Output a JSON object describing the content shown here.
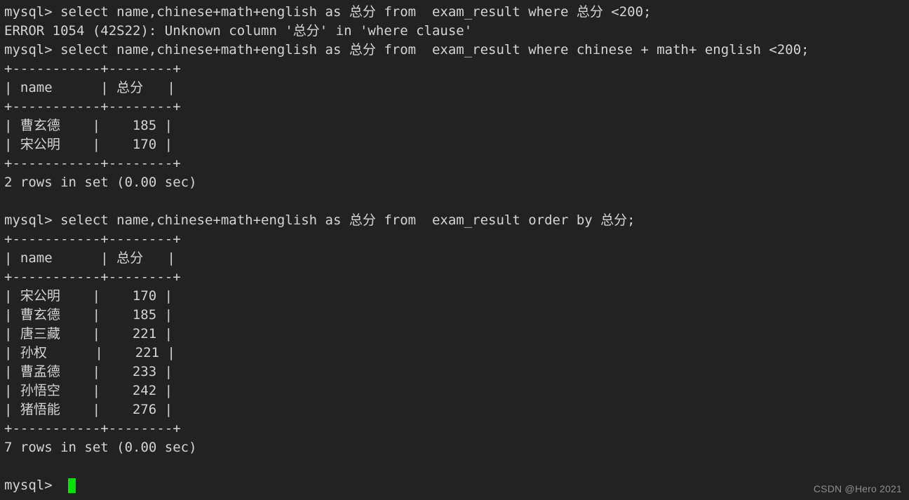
{
  "terminal": {
    "background_color": "#222222",
    "text_color": "#d4d4d4",
    "cursor_color": "#00e400",
    "prompt": "mysql> ",
    "lines": [
      {
        "id": "query-1",
        "text": "mysql> select name,chinese+math+english as 总分 from  exam_result where 总分 <200;"
      },
      {
        "id": "error-1",
        "text": "ERROR 1054 (42S22): Unknown column '总分' in 'where clause'"
      },
      {
        "id": "query-2",
        "text": "mysql> select name,chinese+math+english as 总分 from  exam_result where chinese + math+ english <200;"
      },
      {
        "id": "t1-sep-top",
        "text": "+-----------+--------+"
      },
      {
        "id": "t1-header",
        "text": "| name      | 总分   |"
      },
      {
        "id": "t1-sep-mid",
        "text": "+-----------+--------+"
      },
      {
        "id": "t1-row-1",
        "text": "| 曹玄德    |    185 |"
      },
      {
        "id": "t1-row-2",
        "text": "| 宋公明    |    170 |"
      },
      {
        "id": "t1-sep-bottom",
        "text": "+-----------+--------+"
      },
      {
        "id": "t1-rowcount",
        "text": "2 rows in set (0.00 sec)"
      },
      {
        "id": "spacer-1",
        "text": " "
      },
      {
        "id": "query-3",
        "text": "mysql> select name,chinese+math+english as 总分 from  exam_result order by 总分;"
      },
      {
        "id": "t2-sep-top",
        "text": "+-----------+--------+"
      },
      {
        "id": "t2-header",
        "text": "| name      | 总分   |"
      },
      {
        "id": "t2-sep-mid",
        "text": "+-----------+--------+"
      },
      {
        "id": "t2-row-1",
        "text": "| 宋公明    |    170 |"
      },
      {
        "id": "t2-row-2",
        "text": "| 曹玄德    |    185 |"
      },
      {
        "id": "t2-row-3",
        "text": "| 唐三藏    |    221 |"
      },
      {
        "id": "t2-row-4",
        "text": "| 孙权      |    221 |"
      },
      {
        "id": "t2-row-5",
        "text": "| 曹孟德    |    233 |"
      },
      {
        "id": "t2-row-6",
        "text": "| 孙悟空    |    242 |"
      },
      {
        "id": "t2-row-7",
        "text": "| 猪悟能    |    276 |"
      },
      {
        "id": "t2-sep-bottom",
        "text": "+-----------+--------+"
      },
      {
        "id": "t2-rowcount",
        "text": "7 rows in set (0.00 sec)"
      },
      {
        "id": "spacer-2",
        "text": " "
      }
    ],
    "queries": [
      {
        "sql": "select name,chinese+math+english as 总分 from  exam_result where 总分 <200;",
        "result_type": "error",
        "error": {
          "code": "1054",
          "sqlstate": "42S22",
          "message": "Unknown column '总分' in 'where clause'"
        }
      },
      {
        "sql": "select name,chinese+math+english as 总分 from  exam_result where chinese + math+ english <200;",
        "result_type": "table",
        "columns": [
          "name",
          "总分"
        ],
        "rows": [
          [
            "曹玄德",
            "185"
          ],
          [
            "宋公明",
            "170"
          ]
        ],
        "status": "2 rows in set (0.00 sec)"
      },
      {
        "sql": "select name,chinese+math+english as 总分 from  exam_result order by 总分;",
        "result_type": "table",
        "columns": [
          "name",
          "总分"
        ],
        "rows": [
          [
            "宋公明",
            "170"
          ],
          [
            "曹玄德",
            "185"
          ],
          [
            "唐三藏",
            "221"
          ],
          [
            "孙权",
            "221"
          ],
          [
            "曹孟德",
            "233"
          ],
          [
            "孙悟空",
            "242"
          ],
          [
            "猪悟能",
            "276"
          ]
        ],
        "status": "7 rows in set (0.00 sec)"
      }
    ]
  },
  "watermark": {
    "text": "CSDN @Hero 2021",
    "color": "#8d8d8d"
  }
}
